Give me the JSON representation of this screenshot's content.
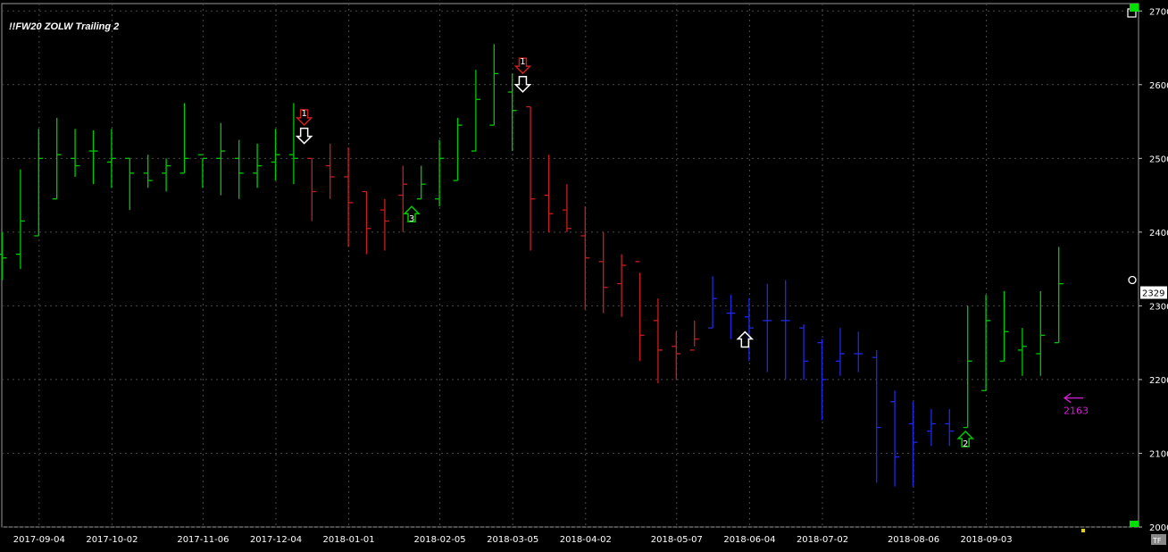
{
  "chart_data": {
    "type": "ohlc",
    "title": "!!FW20 ZOLW Trailing 2",
    "y_axis": {
      "side": "right",
      "ylim": [
        2000,
        2710
      ],
      "ticks": [
        2000,
        2100,
        2200,
        2300,
        2400,
        2500,
        2600,
        2700
      ],
      "tick_labels": [
        "2000",
        "2100",
        "2200",
        "2300",
        "2400",
        "2500",
        "2600",
        "2700"
      ]
    },
    "x_axis": {
      "tick_labels": [
        "2017-09-04",
        "2017-10-02",
        "2017-11-06",
        "2017-12-04",
        "2018-01-01",
        "2018-02-05",
        "2018-03-05",
        "2018-04-02",
        "2018-05-07",
        "2018-06-04",
        "2018-07-02",
        "2018-08-06",
        "2018-09-03"
      ],
      "tick_positions_week": [
        2,
        6,
        11,
        15,
        19,
        24,
        28,
        32,
        37,
        41,
        45,
        50,
        54
      ]
    },
    "grid": true,
    "colors": {
      "background": "#000000",
      "grid": "#4a4a4a",
      "up": "#00c800",
      "down": "#c81e1e",
      "neutral": "#1e28e6",
      "marker_white": "#ffffff",
      "target": "#d21ed2",
      "axis_text": "#ffffff",
      "price_box_bg": "#ffffff"
    },
    "bars": [
      {
        "w": 0,
        "o": 2370,
        "h": 2400,
        "l": 2335,
        "c": 2365,
        "color": "up"
      },
      {
        "w": 1,
        "o": 2370,
        "h": 2485,
        "l": 2350,
        "c": 2415,
        "color": "up"
      },
      {
        "w": 2,
        "o": 2395,
        "h": 2540,
        "l": 2395,
        "c": 2500,
        "color": "up"
      },
      {
        "w": 3,
        "o": 2445,
        "h": 2555,
        "l": 2445,
        "c": 2505,
        "color": "up"
      },
      {
        "w": 4,
        "o": 2500,
        "h": 2540,
        "l": 2475,
        "c": 2490,
        "color": "up"
      },
      {
        "w": 5,
        "o": 2510,
        "h": 2538,
        "l": 2465,
        "c": 2510,
        "color": "up"
      },
      {
        "w": 6,
        "o": 2495,
        "h": 2540,
        "l": 2460,
        "c": 2500,
        "color": "up"
      },
      {
        "w": 7,
        "o": 2500,
        "h": 2500,
        "l": 2430,
        "c": 2480,
        "color": "up"
      },
      {
        "w": 8,
        "o": 2480,
        "h": 2505,
        "l": 2460,
        "c": 2470,
        "color": "up"
      },
      {
        "w": 9,
        "o": 2480,
        "h": 2500,
        "l": 2455,
        "c": 2490,
        "color": "up"
      },
      {
        "w": 10,
        "o": 2480,
        "h": 2575,
        "l": 2480,
        "c": 2500,
        "color": "up"
      },
      {
        "w": 11,
        "o": 2505,
        "h": 2500,
        "l": 2460,
        "c": 2500,
        "color": "up"
      },
      {
        "w": 12,
        "o": 2500,
        "h": 2548,
        "l": 2450,
        "c": 2510,
        "color": "up"
      },
      {
        "w": 13,
        "o": 2500,
        "h": 2525,
        "l": 2445,
        "c": 2480,
        "color": "up"
      },
      {
        "w": 14,
        "o": 2480,
        "h": 2520,
        "l": 2460,
        "c": 2490,
        "color": "up"
      },
      {
        "w": 15,
        "o": 2495,
        "h": 2540,
        "l": 2470,
        "c": 2505,
        "color": "up"
      },
      {
        "w": 16,
        "o": 2505,
        "h": 2575,
        "l": 2465,
        "c": 2500,
        "color": "up"
      },
      {
        "w": 17,
        "o": 2500,
        "h": 2500,
        "l": 2415,
        "c": 2455,
        "color": "down"
      },
      {
        "w": 18,
        "o": 2490,
        "h": 2520,
        "l": 2445,
        "c": 2475,
        "color": "down"
      },
      {
        "w": 19,
        "o": 2475,
        "h": 2515,
        "l": 2380,
        "c": 2440,
        "color": "down"
      },
      {
        "w": 20,
        "o": 2455,
        "h": 2455,
        "l": 2370,
        "c": 2405,
        "color": "down"
      },
      {
        "w": 21,
        "o": 2430,
        "h": 2445,
        "l": 2375,
        "c": 2415,
        "color": "down"
      },
      {
        "w": 22,
        "o": 2450,
        "h": 2490,
        "l": 2400,
        "c": 2465,
        "color": "down"
      },
      {
        "w": 23,
        "o": 2445,
        "h": 2490,
        "l": 2445,
        "c": 2465,
        "color": "up"
      },
      {
        "w": 24,
        "o": 2445,
        "h": 2525,
        "l": 2435,
        "c": 2500,
        "color": "up"
      },
      {
        "w": 25,
        "o": 2470,
        "h": 2555,
        "l": 2470,
        "c": 2545,
        "color": "up"
      },
      {
        "w": 26,
        "o": 2510,
        "h": 2620,
        "l": 2510,
        "c": 2580,
        "color": "up"
      },
      {
        "w": 27,
        "o": 2545,
        "h": 2655,
        "l": 2545,
        "c": 2615,
        "color": "up"
      },
      {
        "w": 28,
        "o": 2590,
        "h": 2615,
        "l": 2510,
        "c": 2565,
        "color": "up"
      },
      {
        "w": 29,
        "o": 2570,
        "h": 2570,
        "l": 2375,
        "c": 2445,
        "color": "down"
      },
      {
        "w": 30,
        "o": 2450,
        "h": 2505,
        "l": 2400,
        "c": 2425,
        "color": "down"
      },
      {
        "w": 31,
        "o": 2430,
        "h": 2465,
        "l": 2400,
        "c": 2405,
        "color": "down"
      },
      {
        "w": 32,
        "o": 2395,
        "h": 2435,
        "l": 2295,
        "c": 2365,
        "color": "down"
      },
      {
        "w": 33,
        "o": 2360,
        "h": 2400,
        "l": 2290,
        "c": 2325,
        "color": "down"
      },
      {
        "w": 34,
        "o": 2330,
        "h": 2370,
        "l": 2285,
        "c": 2355,
        "color": "down"
      },
      {
        "w": 35,
        "o": 2360,
        "h": 2345,
        "l": 2225,
        "c": 2260,
        "color": "down"
      },
      {
        "w": 36,
        "o": 2280,
        "h": 2310,
        "l": 2195,
        "c": 2240,
        "color": "down"
      },
      {
        "w": 37,
        "o": 2245,
        "h": 2265,
        "l": 2200,
        "c": 2235,
        "color": "down"
      },
      {
        "w": 38,
        "o": 2240,
        "h": 2280,
        "l": 2245,
        "c": 2255,
        "color": "down"
      },
      {
        "w": 39,
        "o": 2270,
        "h": 2340,
        "l": 2270,
        "c": 2310,
        "color": "neutral"
      },
      {
        "w": 40,
        "o": 2290,
        "h": 2315,
        "l": 2255,
        "c": 2290,
        "color": "neutral"
      },
      {
        "w": 41,
        "o": 2285,
        "h": 2310,
        "l": 2225,
        "c": 2270,
        "color": "neutral"
      },
      {
        "w": 42,
        "o": 2280,
        "h": 2330,
        "l": 2210,
        "c": 2280,
        "color": "neutral"
      },
      {
        "w": 43,
        "o": 2280,
        "h": 2335,
        "l": 2200,
        "c": 2280,
        "color": "neutral"
      },
      {
        "w": 44,
        "o": 2270,
        "h": 2275,
        "l": 2200,
        "c": 2225,
        "color": "neutral"
      },
      {
        "w": 45,
        "o": 2250,
        "h": 2255,
        "l": 2145,
        "c": 2200,
        "color": "neutral"
      },
      {
        "w": 46,
        "o": 2225,
        "h": 2270,
        "l": 2205,
        "c": 2235,
        "color": "neutral"
      },
      {
        "w": 47,
        "o": 2235,
        "h": 2265,
        "l": 2210,
        "c": 2235,
        "color": "neutral"
      },
      {
        "w": 48,
        "o": 2230,
        "h": 2240,
        "l": 2060,
        "c": 2135,
        "color": "neutral"
      },
      {
        "w": 49,
        "o": 2170,
        "h": 2185,
        "l": 2055,
        "c": 2095,
        "color": "neutral"
      },
      {
        "w": 50,
        "o": 2140,
        "h": 2170,
        "l": 2055,
        "c": 2115,
        "color": "neutral"
      },
      {
        "w": 51,
        "o": 2130,
        "h": 2160,
        "l": 2110,
        "c": 2140,
        "color": "neutral"
      },
      {
        "w": 52,
        "o": 2140,
        "h": 2160,
        "l": 2110,
        "c": 2130,
        "color": "neutral"
      },
      {
        "w": 53,
        "o": 2135,
        "h": 2300,
        "l": 2135,
        "c": 2225,
        "color": "up"
      },
      {
        "w": 54,
        "o": 2185,
        "h": 2315,
        "l": 2185,
        "c": 2280,
        "color": "up"
      },
      {
        "w": 55,
        "o": 2225,
        "h": 2320,
        "l": 2225,
        "c": 2265,
        "color": "up"
      },
      {
        "w": 56,
        "o": 2240,
        "h": 2270,
        "l": 2205,
        "c": 2245,
        "color": "up"
      },
      {
        "w": 57,
        "o": 2235,
        "h": 2320,
        "l": 2205,
        "c": 2260,
        "color": "up"
      },
      {
        "w": 58,
        "o": 2250,
        "h": 2380,
        "l": 2250,
        "c": 2330,
        "color": "up"
      }
    ],
    "markers": [
      {
        "w": 16.6,
        "price": 2555,
        "dir": "down",
        "label": "1",
        "color": "down"
      },
      {
        "w": 16.6,
        "price": 2530,
        "dir": "down",
        "label": "",
        "color": "marker_white"
      },
      {
        "w": 28.6,
        "price": 2625,
        "dir": "down",
        "label": "1",
        "color": "down"
      },
      {
        "w": 28.6,
        "price": 2600,
        "dir": "down",
        "label": "",
        "color": "marker_white"
      },
      {
        "w": 22.5,
        "price": 2425,
        "dir": "up",
        "label": "3",
        "color": "up"
      },
      {
        "w": 40.8,
        "price": 2255,
        "dir": "up",
        "label": "",
        "color": "marker_white"
      },
      {
        "w": 52.9,
        "price": 2120,
        "dir": "up",
        "label": "2",
        "color": "up"
      }
    ],
    "last_price": "2329",
    "target": {
      "value": "2163",
      "arrow": "left",
      "color": "target"
    },
    "tf_label": "TF"
  }
}
